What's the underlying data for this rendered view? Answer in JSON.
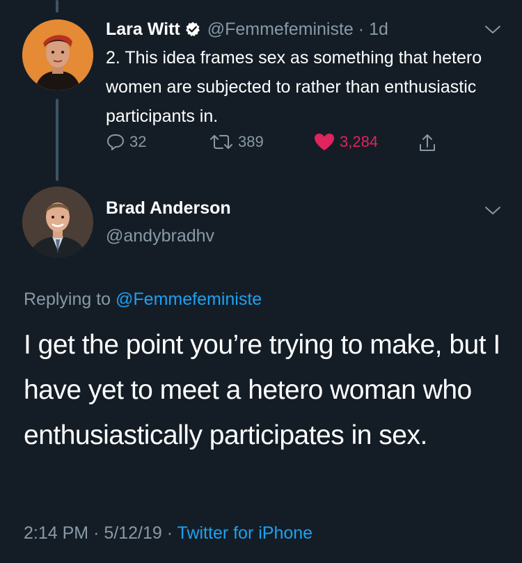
{
  "tweet1": {
    "name": "Lara Witt",
    "handle": "@Femmefeministe",
    "separator": "·",
    "time": "1d",
    "text": "2. This idea frames sex as something that hetero women are subjected to rather than enthusiastic participants in.",
    "replies": "32",
    "retweets": "389",
    "likes": "3,284"
  },
  "tweet2": {
    "name": "Brad Anderson",
    "handle": "@andybradhv",
    "replying_prefix": "Replying to",
    "replying_to": "@Femmefeministe",
    "text": "I get the point you’re trying to make, but I have yet to meet a hetero woman who enthusiastically participates in sex.",
    "time": "2:14 PM",
    "sep1": "·",
    "date": "5/12/19",
    "sep2": "·",
    "source": "Twitter for iPhone"
  },
  "colors": {
    "background": "#141d26",
    "secondary_text": "#8899a6",
    "link": "#1da1f2",
    "like": "#e0245e"
  },
  "icons": [
    "verified-icon",
    "chevron-down-icon",
    "reply-icon",
    "retweet-icon",
    "heart-icon",
    "share-icon"
  ]
}
